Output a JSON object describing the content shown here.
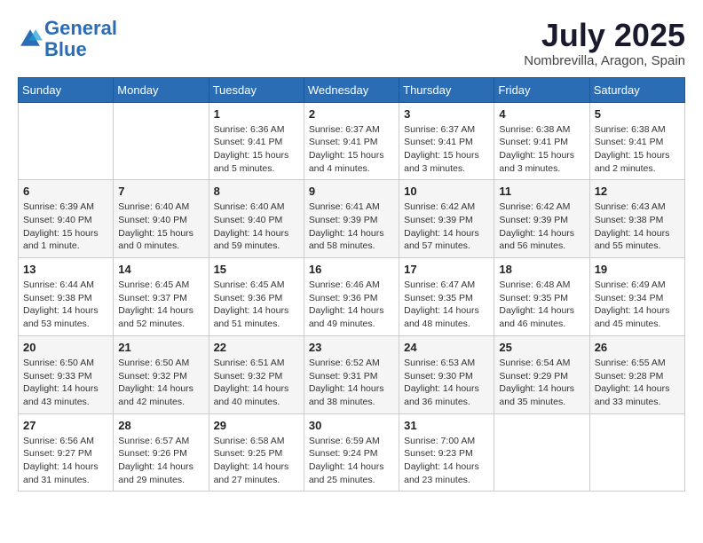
{
  "header": {
    "logo_line1": "General",
    "logo_line2": "Blue",
    "month_year": "July 2025",
    "location": "Nombrevilla, Aragon, Spain"
  },
  "weekdays": [
    "Sunday",
    "Monday",
    "Tuesday",
    "Wednesday",
    "Thursday",
    "Friday",
    "Saturday"
  ],
  "weeks": [
    [
      {
        "day": "",
        "info": ""
      },
      {
        "day": "",
        "info": ""
      },
      {
        "day": "1",
        "info": "Sunrise: 6:36 AM\nSunset: 9:41 PM\nDaylight: 15 hours\nand 5 minutes."
      },
      {
        "day": "2",
        "info": "Sunrise: 6:37 AM\nSunset: 9:41 PM\nDaylight: 15 hours\nand 4 minutes."
      },
      {
        "day": "3",
        "info": "Sunrise: 6:37 AM\nSunset: 9:41 PM\nDaylight: 15 hours\nand 3 minutes."
      },
      {
        "day": "4",
        "info": "Sunrise: 6:38 AM\nSunset: 9:41 PM\nDaylight: 15 hours\nand 3 minutes."
      },
      {
        "day": "5",
        "info": "Sunrise: 6:38 AM\nSunset: 9:41 PM\nDaylight: 15 hours\nand 2 minutes."
      }
    ],
    [
      {
        "day": "6",
        "info": "Sunrise: 6:39 AM\nSunset: 9:40 PM\nDaylight: 15 hours\nand 1 minute."
      },
      {
        "day": "7",
        "info": "Sunrise: 6:40 AM\nSunset: 9:40 PM\nDaylight: 15 hours\nand 0 minutes."
      },
      {
        "day": "8",
        "info": "Sunrise: 6:40 AM\nSunset: 9:40 PM\nDaylight: 14 hours\nand 59 minutes."
      },
      {
        "day": "9",
        "info": "Sunrise: 6:41 AM\nSunset: 9:39 PM\nDaylight: 14 hours\nand 58 minutes."
      },
      {
        "day": "10",
        "info": "Sunrise: 6:42 AM\nSunset: 9:39 PM\nDaylight: 14 hours\nand 57 minutes."
      },
      {
        "day": "11",
        "info": "Sunrise: 6:42 AM\nSunset: 9:39 PM\nDaylight: 14 hours\nand 56 minutes."
      },
      {
        "day": "12",
        "info": "Sunrise: 6:43 AM\nSunset: 9:38 PM\nDaylight: 14 hours\nand 55 minutes."
      }
    ],
    [
      {
        "day": "13",
        "info": "Sunrise: 6:44 AM\nSunset: 9:38 PM\nDaylight: 14 hours\nand 53 minutes."
      },
      {
        "day": "14",
        "info": "Sunrise: 6:45 AM\nSunset: 9:37 PM\nDaylight: 14 hours\nand 52 minutes."
      },
      {
        "day": "15",
        "info": "Sunrise: 6:45 AM\nSunset: 9:36 PM\nDaylight: 14 hours\nand 51 minutes."
      },
      {
        "day": "16",
        "info": "Sunrise: 6:46 AM\nSunset: 9:36 PM\nDaylight: 14 hours\nand 49 minutes."
      },
      {
        "day": "17",
        "info": "Sunrise: 6:47 AM\nSunset: 9:35 PM\nDaylight: 14 hours\nand 48 minutes."
      },
      {
        "day": "18",
        "info": "Sunrise: 6:48 AM\nSunset: 9:35 PM\nDaylight: 14 hours\nand 46 minutes."
      },
      {
        "day": "19",
        "info": "Sunrise: 6:49 AM\nSunset: 9:34 PM\nDaylight: 14 hours\nand 45 minutes."
      }
    ],
    [
      {
        "day": "20",
        "info": "Sunrise: 6:50 AM\nSunset: 9:33 PM\nDaylight: 14 hours\nand 43 minutes."
      },
      {
        "day": "21",
        "info": "Sunrise: 6:50 AM\nSunset: 9:32 PM\nDaylight: 14 hours\nand 42 minutes."
      },
      {
        "day": "22",
        "info": "Sunrise: 6:51 AM\nSunset: 9:32 PM\nDaylight: 14 hours\nand 40 minutes."
      },
      {
        "day": "23",
        "info": "Sunrise: 6:52 AM\nSunset: 9:31 PM\nDaylight: 14 hours\nand 38 minutes."
      },
      {
        "day": "24",
        "info": "Sunrise: 6:53 AM\nSunset: 9:30 PM\nDaylight: 14 hours\nand 36 minutes."
      },
      {
        "day": "25",
        "info": "Sunrise: 6:54 AM\nSunset: 9:29 PM\nDaylight: 14 hours\nand 35 minutes."
      },
      {
        "day": "26",
        "info": "Sunrise: 6:55 AM\nSunset: 9:28 PM\nDaylight: 14 hours\nand 33 minutes."
      }
    ],
    [
      {
        "day": "27",
        "info": "Sunrise: 6:56 AM\nSunset: 9:27 PM\nDaylight: 14 hours\nand 31 minutes."
      },
      {
        "day": "28",
        "info": "Sunrise: 6:57 AM\nSunset: 9:26 PM\nDaylight: 14 hours\nand 29 minutes."
      },
      {
        "day": "29",
        "info": "Sunrise: 6:58 AM\nSunset: 9:25 PM\nDaylight: 14 hours\nand 27 minutes."
      },
      {
        "day": "30",
        "info": "Sunrise: 6:59 AM\nSunset: 9:24 PM\nDaylight: 14 hours\nand 25 minutes."
      },
      {
        "day": "31",
        "info": "Sunrise: 7:00 AM\nSunset: 9:23 PM\nDaylight: 14 hours\nand 23 minutes."
      },
      {
        "day": "",
        "info": ""
      },
      {
        "day": "",
        "info": ""
      }
    ]
  ]
}
